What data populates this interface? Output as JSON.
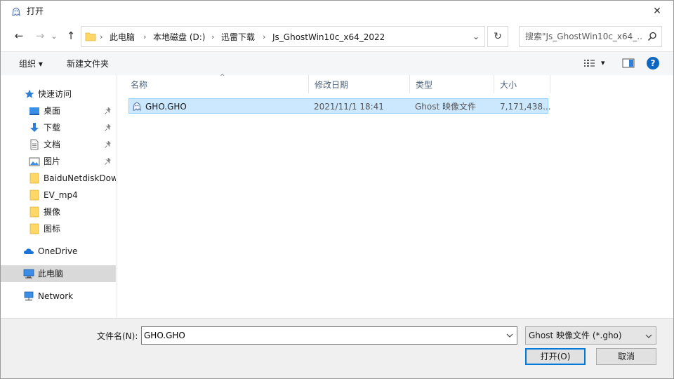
{
  "window": {
    "title": "打开",
    "close_glyph": "✕"
  },
  "nav": {
    "back_glyph": "←",
    "forward_glyph": "→",
    "recent_glyph": "⌄",
    "up_glyph": "↑",
    "breadcrumbs": [
      "此电脑",
      "本地磁盘 (D:)",
      "迅雷下载",
      "Js_GhostWin10c_x64_2022"
    ],
    "crumb_sep": "›",
    "dropdown_glyph": "⌄",
    "refresh_glyph": "↻",
    "search_placeholder": "搜索\"Js_GhostWin10c_x64_..."
  },
  "toolbar": {
    "organize": "组织 ▾",
    "new_folder": "新建文件夹",
    "view_dd_glyph": "▾",
    "help_glyph": "?"
  },
  "sidebar": {
    "quick_access": "快速访问",
    "items": [
      {
        "label": "桌面",
        "pinned": true
      },
      {
        "label": "下载",
        "pinned": true
      },
      {
        "label": "文档",
        "pinned": true
      },
      {
        "label": "图片",
        "pinned": true
      },
      {
        "label": "BaiduNetdiskDow",
        "pinned": false
      },
      {
        "label": "EV_mp4",
        "pinned": false
      },
      {
        "label": "摄像",
        "pinned": false
      },
      {
        "label": "图标",
        "pinned": false
      }
    ],
    "onedrive": "OneDrive",
    "this_pc": "此电脑",
    "network": "Network"
  },
  "columns": {
    "name": "名称",
    "modified": "修改日期",
    "type": "类型",
    "size": "大小",
    "sort_glyph": "^"
  },
  "files": [
    {
      "name": "GHO.GHO",
      "modified": "2021/11/1 18:41",
      "type": "Ghost 映像文件",
      "size": "7,171,438..."
    }
  ],
  "bottom": {
    "filename_label": "文件名(N):",
    "filename_value": "GHO.GHO",
    "filetype": "Ghost 映像文件 (*.gho)",
    "open_button": "打开(O)",
    "cancel_button": "取消"
  },
  "colors": {
    "accent": "#0078d7",
    "selection": "#cce8ff",
    "folder": "#ffd766",
    "quick_star": "#2f7fd6"
  }
}
